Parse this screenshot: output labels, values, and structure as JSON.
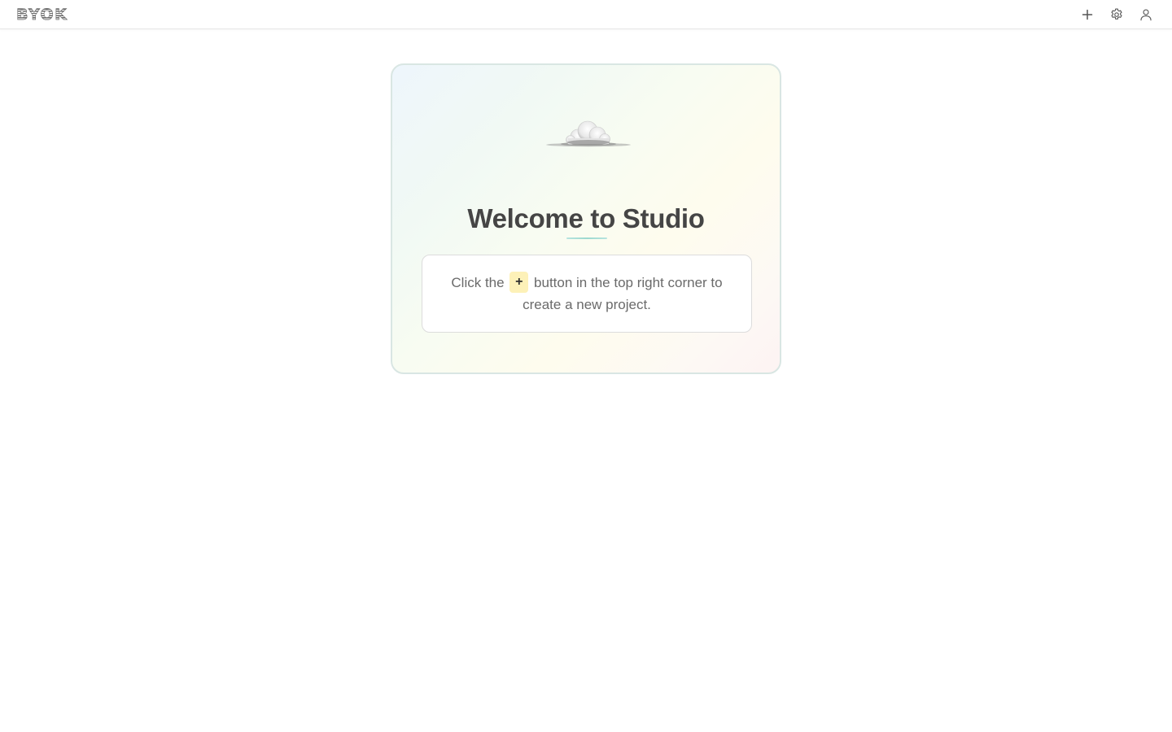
{
  "header": {
    "logo_text": "BYOK",
    "actions": [
      {
        "name": "new-project",
        "icon": "plus-icon"
      },
      {
        "name": "settings",
        "icon": "gear-icon"
      },
      {
        "name": "account",
        "icon": "user-icon"
      }
    ]
  },
  "welcome": {
    "illustration": "cloud",
    "title": "Welcome to Studio",
    "instruction_before": "Click the",
    "instruction_chip": "+",
    "instruction_after": "button in the top right corner to create a new project."
  },
  "colors": {
    "title": "#454545",
    "text": "#6a6a6a",
    "chip_bg": "#fdf1b8",
    "card_border": "#d9e6e3"
  }
}
